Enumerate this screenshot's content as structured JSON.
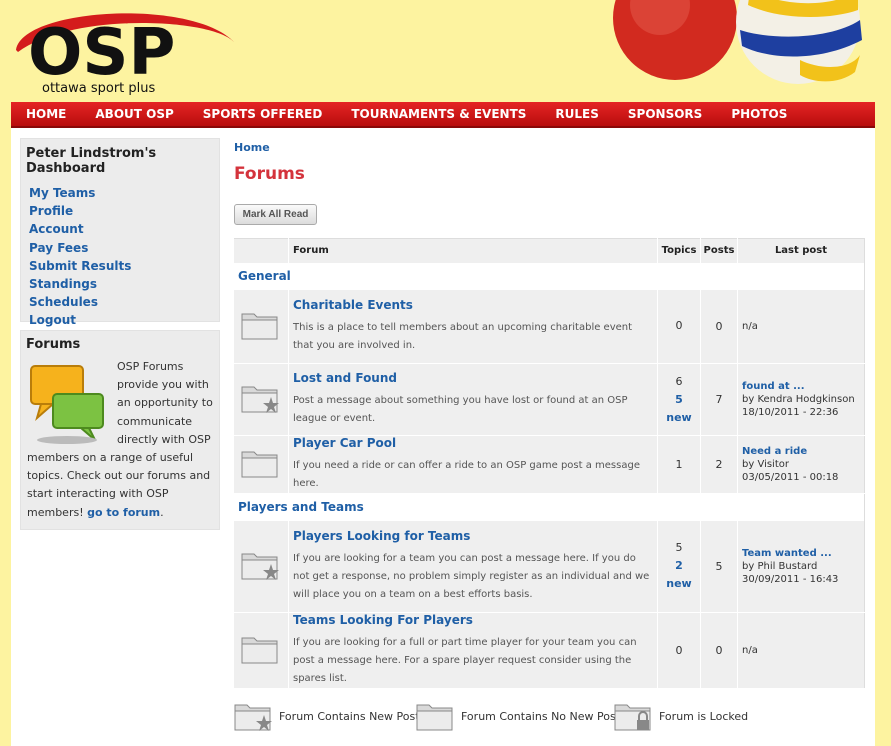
{
  "header": {
    "logo_text": "OSP",
    "logo_tagline": "ottawa sport plus"
  },
  "nav": [
    "HOME",
    "ABOUT OSP",
    "SPORTS OFFERED",
    "TOURNAMENTS & EVENTS",
    "RULES",
    "SPONSORS",
    "PHOTOS"
  ],
  "dashboard": {
    "title": "Peter Lindstrom's Dashboard",
    "links": [
      "My Teams",
      "Profile",
      "Account",
      "Pay Fees",
      "Submit Results",
      "Standings",
      "Schedules",
      "Logout"
    ]
  },
  "forums_box": {
    "title": "Forums",
    "text": "OSP Forums provide you with an opportunity to communicate directly with OSP members on a range of useful topics. Check out our forums and start interacting with OSP members!",
    "link": "go to forum",
    "link_suffix": "."
  },
  "main": {
    "breadcrumb": "Home",
    "title": "Forums",
    "mark_all_read": "Mark All Read"
  },
  "table": {
    "headers": {
      "forum": "Forum",
      "topics": "Topics",
      "posts": "Posts",
      "last_post": "Last post"
    },
    "categories": [
      {
        "name": "General",
        "forums": [
          {
            "title": "Charitable Events",
            "desc": "This is a place to tell members about an upcoming charitable event that you are involved in.",
            "icon": "folder-icon",
            "topics": "0",
            "new": "",
            "posts": "0",
            "last": {
              "title": "",
              "by": "n/a",
              "date": ""
            }
          },
          {
            "title": "Lost and Found",
            "desc": "Post a message about something you have lost or found at an OSP league or event.",
            "icon": "folder-new-icon",
            "topics": "6",
            "new": "5 new",
            "posts": "7",
            "last": {
              "title": "found at ...",
              "by": "by Kendra Hodgkinson",
              "date": "18/10/2011 - 22:36"
            }
          },
          {
            "title": "Player Car Pool",
            "desc": "If you need a ride or can offer a ride to an OSP game post a message here.",
            "icon": "folder-icon",
            "topics": "1",
            "new": "",
            "posts": "2",
            "last": {
              "title": "Need a ride",
              "by": "by Visitor",
              "date": "03/05/2011 - 00:18"
            }
          }
        ]
      },
      {
        "name": "Players and Teams",
        "forums": [
          {
            "title": "Players Looking for Teams",
            "desc": "If you are looking for a team you can post a message here. If you do not get a response, no problem simply register as an individual and we will place you on a team on a best efforts basis.",
            "icon": "folder-new-icon",
            "topics": "5",
            "new": "2 new",
            "posts": "5",
            "last": {
              "title": "Team wanted ...",
              "by": "by Phil Bustard",
              "date": "30/09/2011 - 16:43"
            }
          },
          {
            "title": "Teams Looking For Players",
            "desc": "If you are looking for a full or part time player for your team you can post a message here. For a spare player request consider using the spares list.",
            "icon": "folder-icon",
            "topics": "0",
            "new": "",
            "posts": "0",
            "last": {
              "title": "",
              "by": "n/a",
              "date": ""
            }
          }
        ]
      }
    ]
  },
  "legend": {
    "new_posts": "Forum Contains New Posts",
    "no_new_posts": "Forum Contains No New Posts",
    "locked": "Forum is Locked"
  },
  "colors": {
    "nav_red": "#d41c1c",
    "link_blue": "#1f5fa6",
    "title_red": "#d4333c",
    "page_yellow": "#fdf3a0"
  }
}
